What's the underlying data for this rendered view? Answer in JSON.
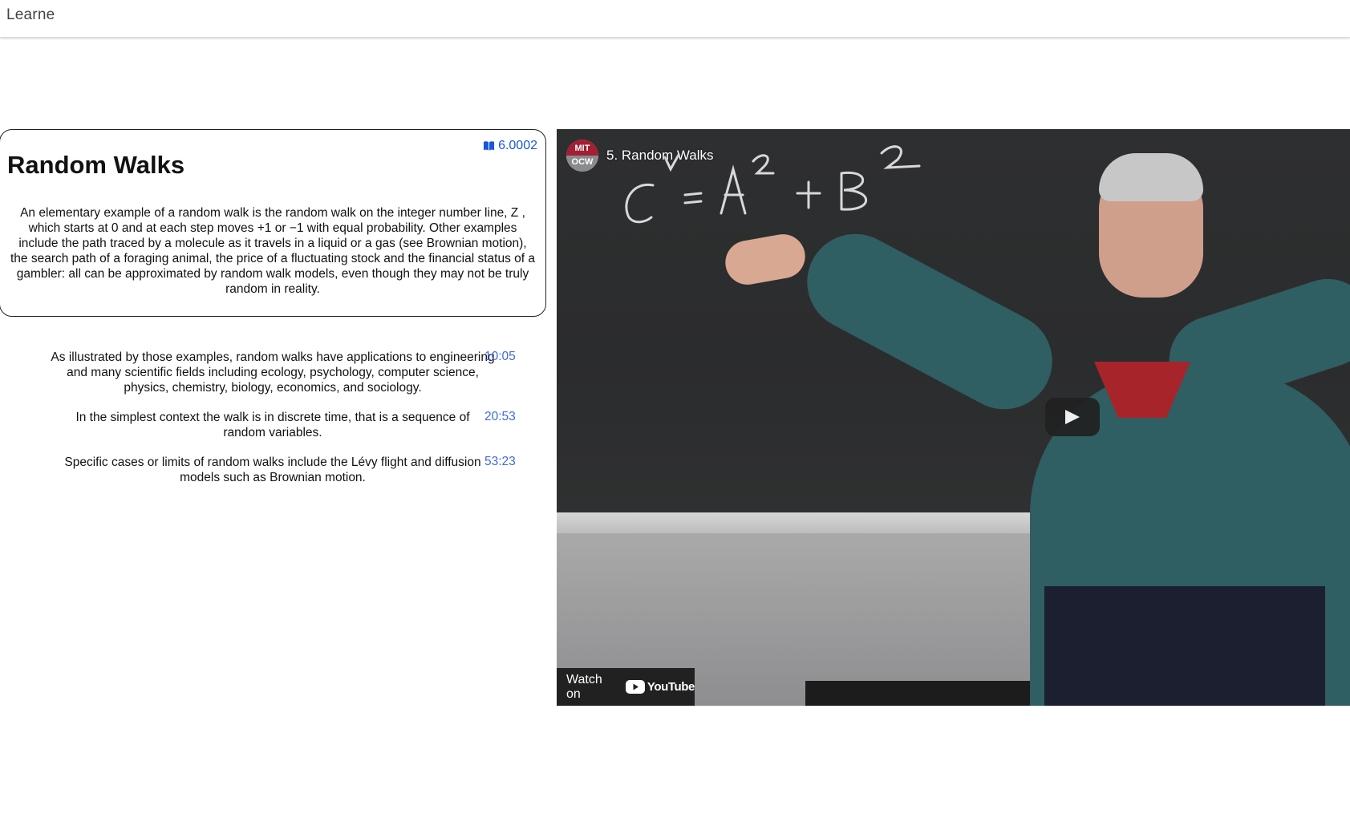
{
  "header": {
    "brand": "Learne"
  },
  "card": {
    "course_code": "6.0002",
    "title": "Random Walks",
    "description": "An elementary example of a random walk is the random walk on the integer number line, Z , which starts at 0 and at each step moves +1 or −1 with equal probability. Other examples include the path traced by a molecule as it travels in a liquid or a gas (see Brownian motion), the search path of a foraging animal, the price of a fluctuating stock and the financial status of a gambler: all can be approximated by random walk models, even though they may not be truly random in reality."
  },
  "chapters": [
    {
      "text": "As illustrated by those examples, random walks have applications to engineering and many scientific fields including ecology, psychology, computer science, physics, chemistry, biology, economics, and sociology.",
      "time": "10:05"
    },
    {
      "text": "In the simplest context the walk is in discrete time, that is a sequence of random variables.",
      "time": "20:53"
    },
    {
      "text": "Specific cases or limits of random walks include the Lévy flight and diffusion models such as Brownian motion.",
      "time": "53:23"
    }
  ],
  "video": {
    "title": "5. Random Walks",
    "channel_top": "MIT",
    "channel_bottom": "OCW",
    "watch_on": "Watch on",
    "youtube_word": "YouTube"
  },
  "icons": {
    "course": "book-icon",
    "play": "play-icon",
    "youtube": "youtube-icon"
  },
  "colors": {
    "link": "#4169e1",
    "course_tag": "#1a56db",
    "youtube_red": "#ff0000"
  }
}
